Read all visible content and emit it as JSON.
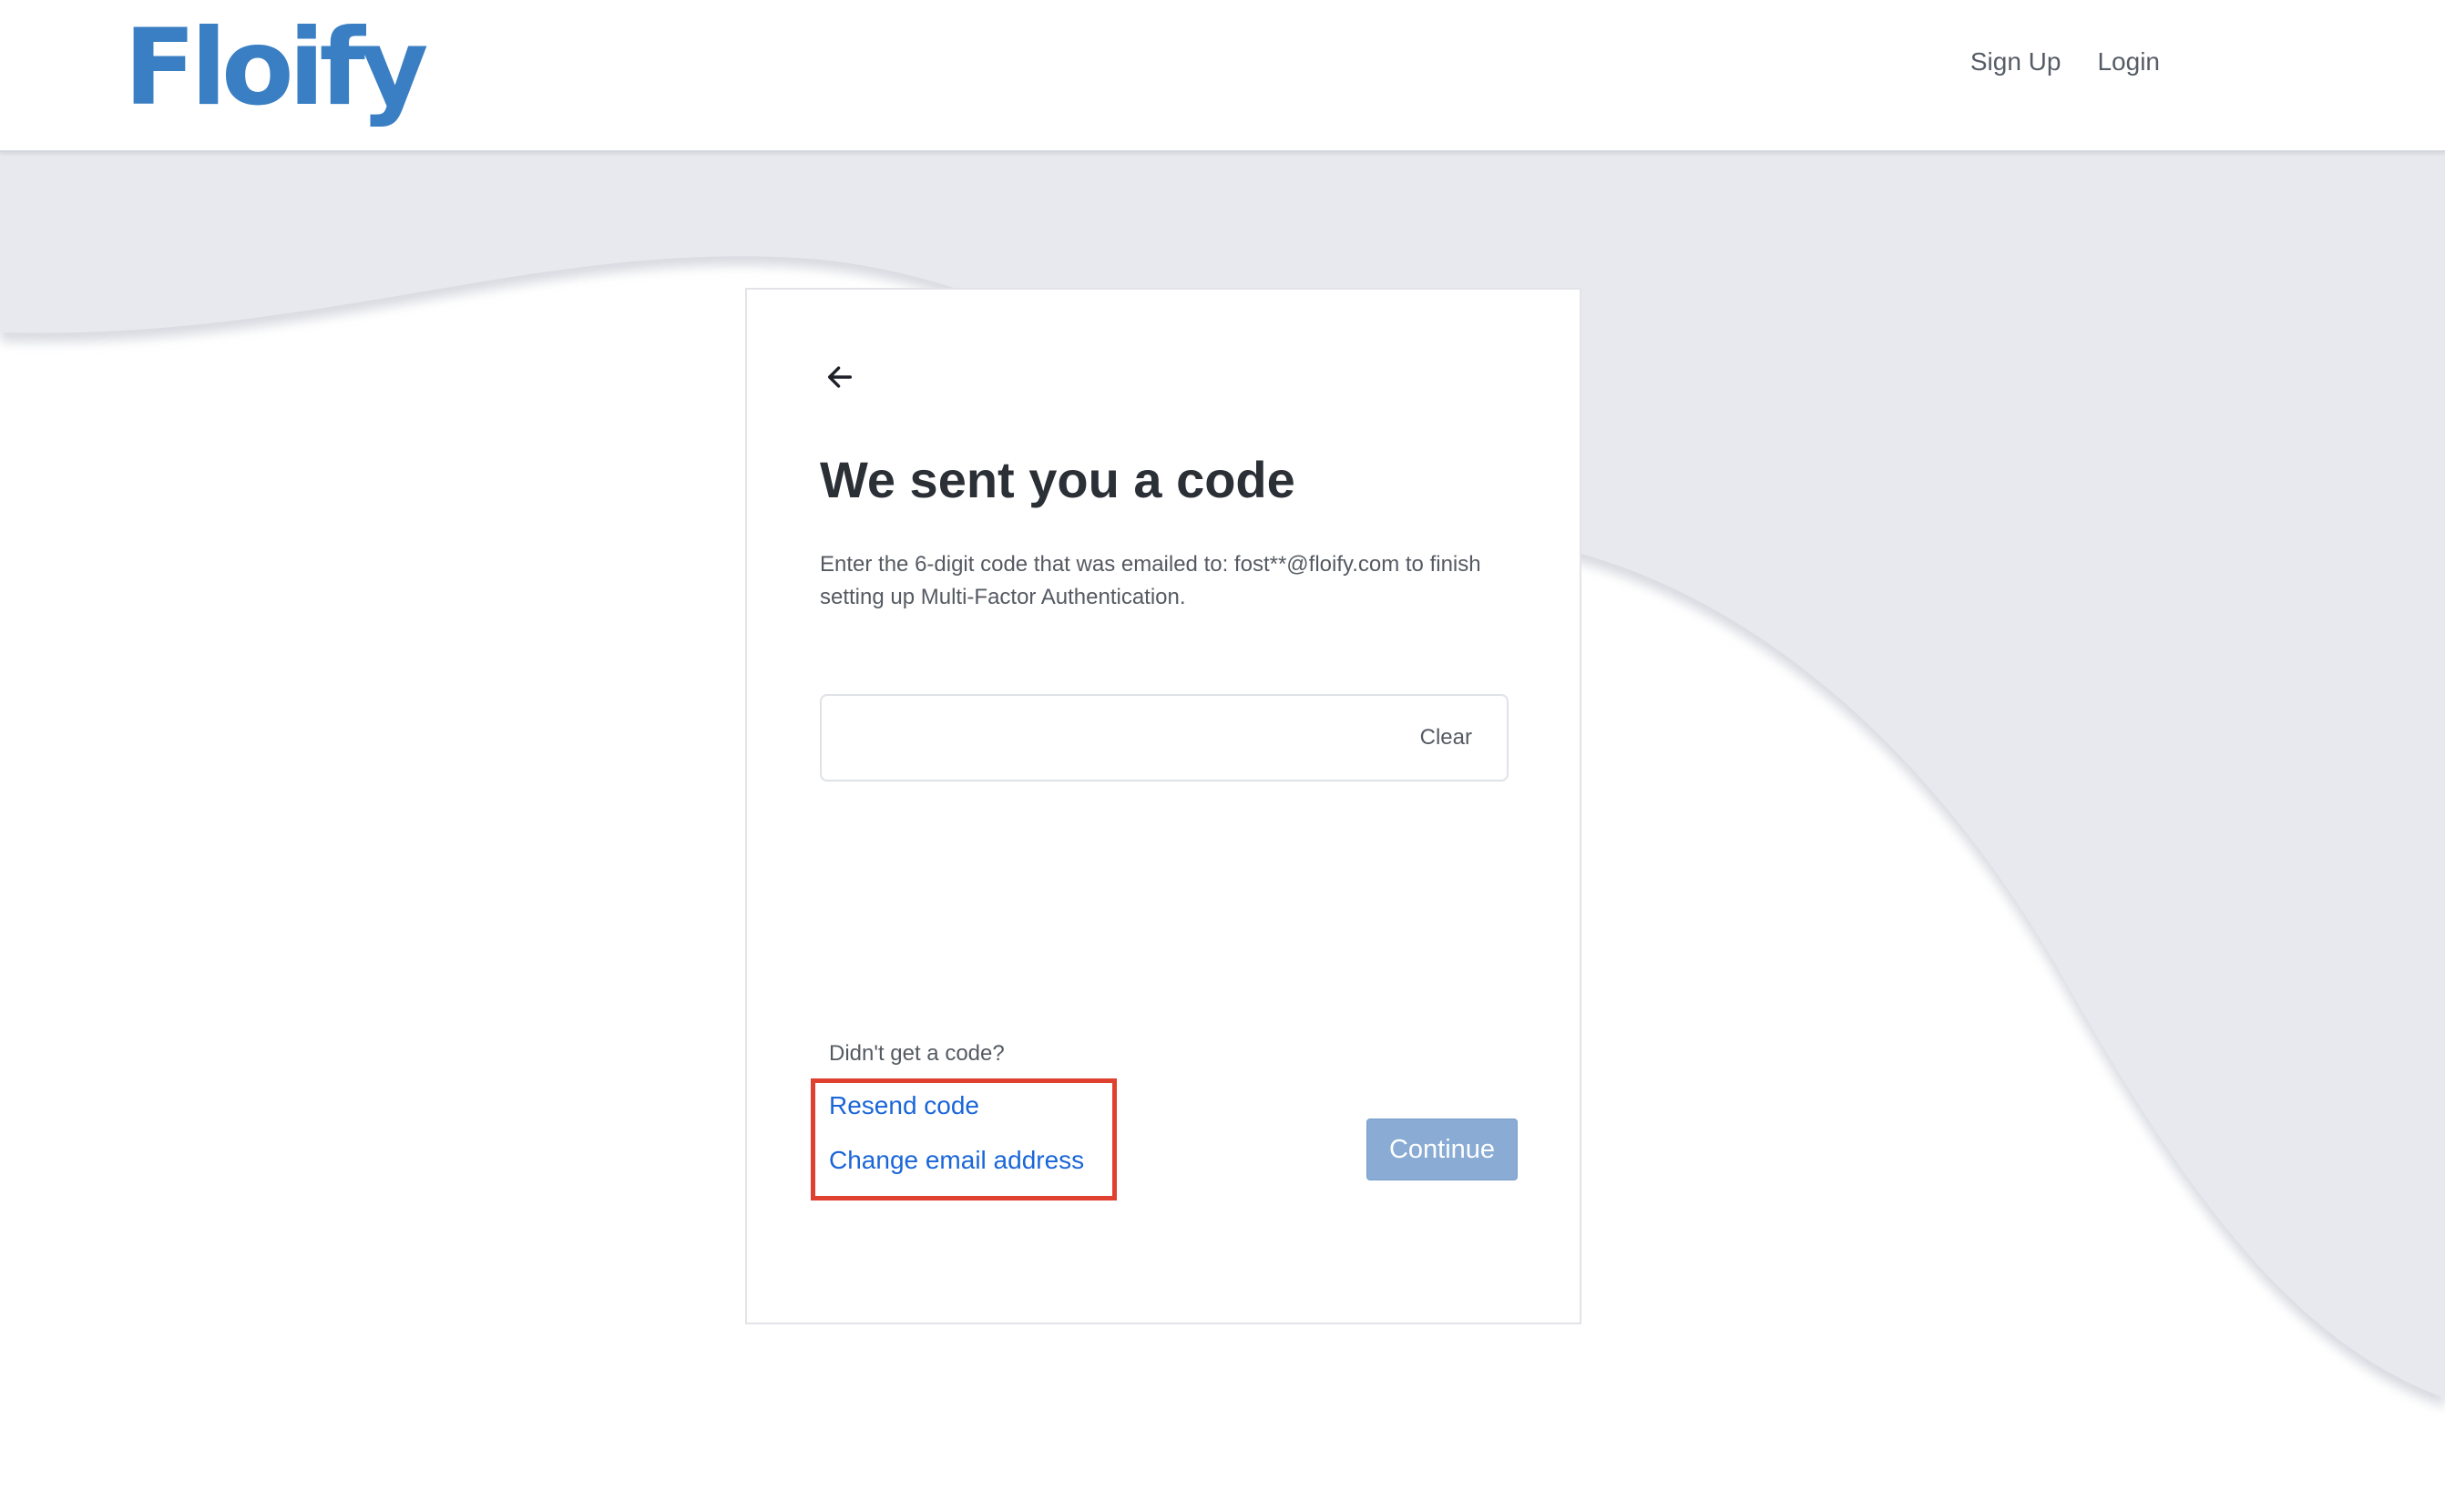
{
  "header": {
    "logo_text": "Floify",
    "nav": {
      "sign_up": "Sign Up",
      "login": "Login"
    }
  },
  "card": {
    "back_icon": "arrow-left-icon",
    "title": "We sent you a code",
    "description": "Enter the 6-digit code that was emailed to: fost**@floify.com to finish setting up Multi-Factor Authentication.",
    "code_input": {
      "value": "",
      "placeholder": ""
    },
    "clear_label": "Clear",
    "no_code_prompt": "Didn't get a code?",
    "resend_label": "Resend code",
    "change_email_label": "Change email address",
    "continue_label": "Continue"
  },
  "colors": {
    "brand": "#3a7fc3",
    "link": "#1a66d8",
    "button_disabled": "#89abd4",
    "highlight": "#e0402f",
    "background_wave": "#e8e9ee"
  }
}
